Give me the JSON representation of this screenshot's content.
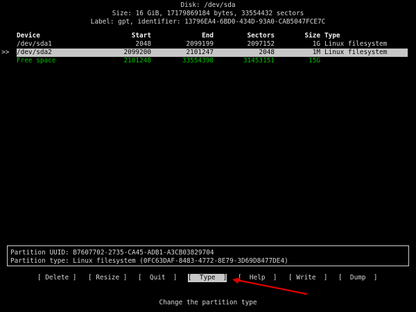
{
  "header": {
    "disk_line": "Disk: /dev/sda",
    "size_line": "Size: 16 GiB, 17179869184 bytes, 33554432 sectors",
    "label_line": "Label: gpt, identifier: 13796EA4-6BD0-434D-93A0-CAB5047FCE7C"
  },
  "table": {
    "columns": {
      "device": "Device",
      "start": "Start",
      "end": "End",
      "sectors": "Sectors",
      "size": "Size",
      "type": "Type"
    },
    "rows": [
      {
        "selector": "",
        "device": "/dev/sda1",
        "start": "2048",
        "end": "2099199",
        "sectors": "2097152",
        "size": "1G",
        "type": "Linux filesystem"
      },
      {
        "selector": ">>",
        "device": "/dev/sda2",
        "start": "2099200",
        "end": "2101247",
        "sectors": "2048",
        "size": "1M",
        "type": "Linux filesystem"
      },
      {
        "selector": "",
        "device": "Free space",
        "start": "2101248",
        "end": "33554398",
        "sectors": "31453151",
        "size": "15G",
        "type": ""
      }
    ]
  },
  "info": {
    "uuid_line": "Partition UUID: B7607702-2735-CA45-ADB1-A3CB03829704",
    "type_line": "Partition type: Linux filesystem (0FC63DAF-8483-4772-8E79-3D69D8477DE4)"
  },
  "menu": {
    "items": [
      {
        "label": "[ Delete ]"
      },
      {
        "label": "[ Resize ]"
      },
      {
        "label": "[  Quit  ]"
      },
      {
        "label": "[  Type  ]"
      },
      {
        "label": "[  Help  ]"
      },
      {
        "label": "[ Write  ]"
      },
      {
        "label": "[  Dump  ]"
      }
    ],
    "hint": "Change the partition type"
  },
  "colors": {
    "background": "#000000",
    "text": "#d7d7d7",
    "selection": "#c7c7c7",
    "free_space": "#00c000",
    "annotation": "#e00000"
  }
}
